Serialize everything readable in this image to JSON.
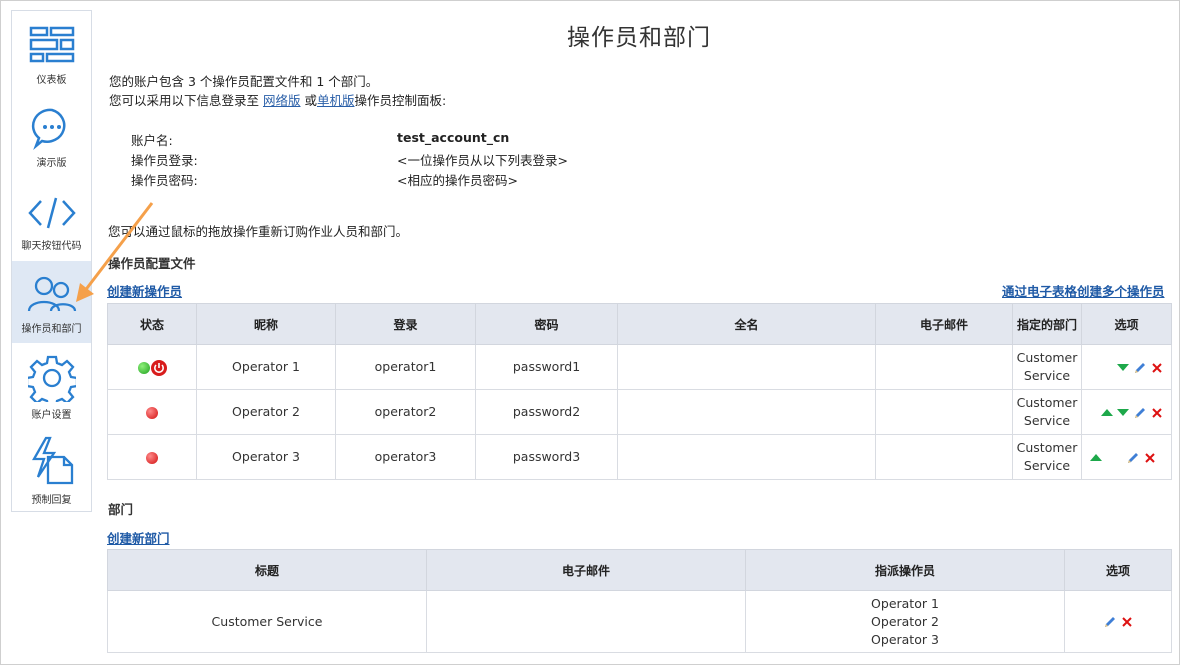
{
  "sidebar": {
    "items": [
      {
        "label": "仪表板",
        "icon": "dashboard-icon"
      },
      {
        "label": "演示版",
        "icon": "chat-bubble-icon"
      },
      {
        "label": "聊天按钮代码",
        "icon": "code-icon"
      },
      {
        "label": "操作员和部门",
        "icon": "users-icon",
        "active": true
      },
      {
        "label": "账户设置",
        "icon": "gear-icon"
      },
      {
        "label": "预制回复",
        "icon": "lightning-doc-icon"
      }
    ]
  },
  "page": {
    "title": "操作员和部门",
    "intro_line1": "您的账户包含 3 个操作员配置文件和 1 个部门。",
    "intro_line2_prefix": "您可以采用以下信息登录至 ",
    "web_link": "网络版",
    "intro_line2_mid": " 或",
    "desktop_link": "单机版",
    "intro_line2_suffix": "操作员控制面板:",
    "account_label": "账户名:",
    "account_value": "test_account_cn",
    "login_label": "操作员登录:",
    "login_value": "<一位操作员从以下列表登录>",
    "password_label": "操作员密码:",
    "password_value": "<相应的操作员密码>",
    "drag_hint": "您可以通过鼠标的拖放操作重新订购作业人员和部门。"
  },
  "operators": {
    "section_title": "操作员配置文件",
    "create_link": "创建新操作员",
    "spreadsheet_link": "通过电子表格创建多个操作员",
    "columns": [
      "状态",
      "昵称",
      "登录",
      "密码",
      "全名",
      "电子邮件",
      "指定的部门",
      "选项"
    ],
    "rows": [
      {
        "nickname": "Operator 1",
        "login": "operator1",
        "password": "password1",
        "fullname": "",
        "email": "",
        "department": "Customer Service",
        "status": "online"
      },
      {
        "nickname": "Operator 2",
        "login": "operator2",
        "password": "password2",
        "fullname": "",
        "email": "",
        "department": "Customer Service",
        "status": "offline"
      },
      {
        "nickname": "Operator 3",
        "login": "operator3",
        "password": "password3",
        "fullname": "",
        "email": "",
        "department": "Customer Service",
        "status": "offline"
      }
    ]
  },
  "departments": {
    "section_title": "部门",
    "create_link": "创建新部门",
    "columns": [
      "标题",
      "电子邮件",
      "指派操作员",
      "选项"
    ],
    "rows": [
      {
        "title": "Customer Service",
        "email": "",
        "operators": [
          "Operator 1",
          "Operator 2",
          "Operator 3"
        ]
      }
    ]
  },
  "colors": {
    "accent": "#2a7fd0",
    "link": "#1f5aa6",
    "arrow": "#f5a04a",
    "online": "#1ea01e",
    "offline": "#d10f0f"
  }
}
